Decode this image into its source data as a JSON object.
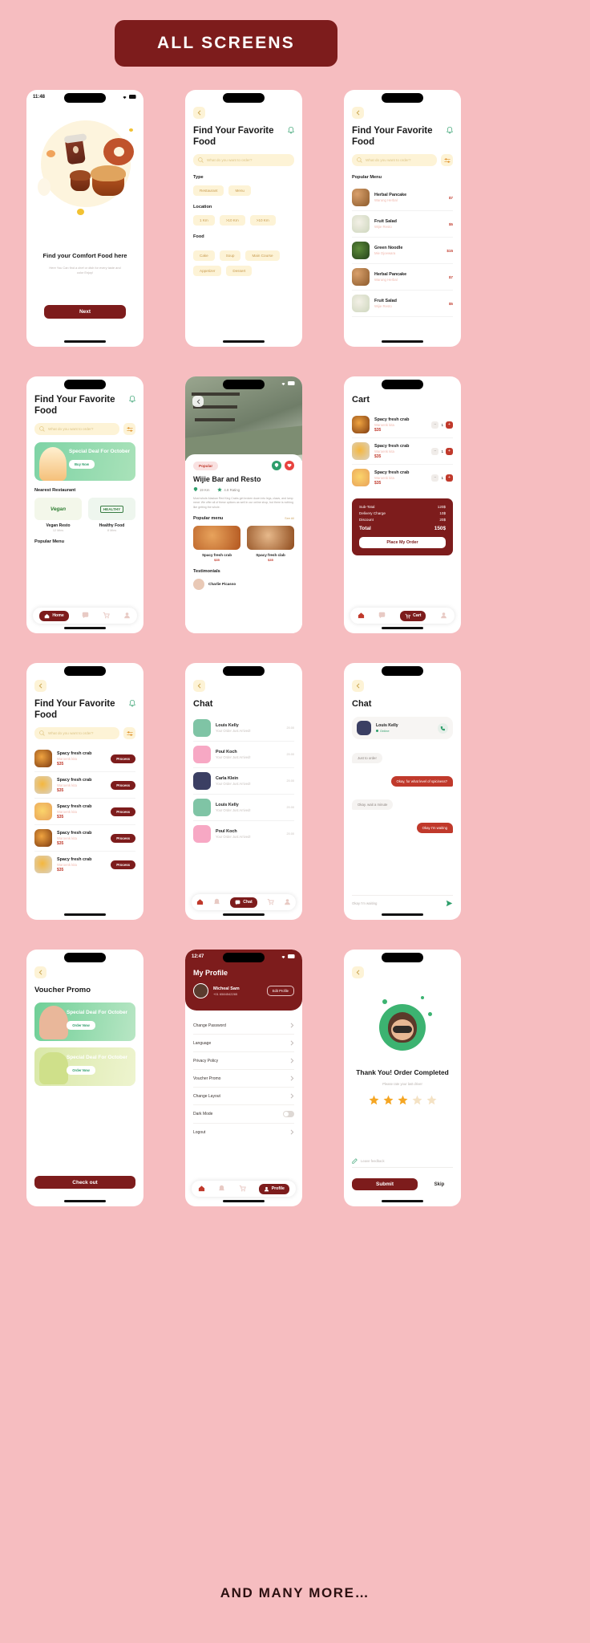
{
  "banner": {
    "title": "ALL SCREENS"
  },
  "footer": {
    "text": "AND MANY MORE…"
  },
  "colors": {
    "background": "#f6bdc0",
    "primary": "#7d1c1c",
    "accent_cream": "#fdf3d6",
    "green": "#2e9e6b",
    "price_red": "#c0392b"
  },
  "common": {
    "status_time": "11:48",
    "search_placeholder": "What do you want to order?",
    "back_icon": "chevron-left-icon",
    "bell_icon": "bell-icon",
    "search_icon": "search-icon",
    "filter_icon": "filter-icon"
  },
  "screens": [
    {
      "id": "onboarding",
      "status_time": "11:48",
      "headline": "Find your Comfort Food here",
      "subtext": "Here You Can find a chef or dish for every taste and color Enjoy!",
      "cta": "Next"
    },
    {
      "id": "search-filters",
      "title": "Find Your Favorite Food",
      "search_placeholder": "What do you want to order?",
      "sections": [
        {
          "label": "Type",
          "chips": [
            "Restaurant",
            "Menu"
          ]
        },
        {
          "label": "Location",
          "chips": [
            "1 Km",
            ">10 Km",
            ">10 Km"
          ]
        },
        {
          "label": "Food",
          "chips": [
            "Cake",
            "Soup",
            "Main Course",
            "Appetizer",
            "Dessert"
          ]
        }
      ]
    },
    {
      "id": "popular-menu",
      "title": "Find Your Favorite Food",
      "search_placeholder": "What do you want to order?",
      "section_label": "Popular Menu",
      "items": [
        {
          "name": "Herbal Pancake",
          "sub": "Warung Herbal",
          "price": "$7"
        },
        {
          "name": "Fruit Salad",
          "sub": "Wijie Resto",
          "price": "$5"
        },
        {
          "name": "Green Noodle",
          "sub": "Mie Djoewara",
          "price": "$15"
        },
        {
          "name": "Herbal Pancake",
          "sub": "Warung Herbal",
          "price": "$7"
        },
        {
          "name": "Fruit Salad",
          "sub": "Wijie Resto",
          "price": "$5"
        }
      ]
    },
    {
      "id": "home",
      "title": "Find Your Favorite Food",
      "search_placeholder": "What do you want to order?",
      "promo": {
        "title": "Special Deal For October",
        "cta": "Buy Now"
      },
      "nearest_label": "Nearest Restaurant",
      "restaurants": [
        {
          "name": "Vegan Resto",
          "distance": "12 Mins",
          "badge": "Vegan"
        },
        {
          "name": "Healthy Food",
          "distance": "8 Mins",
          "badge": "HEALTHY"
        }
      ],
      "popular_label": "Popular Menu",
      "nav": [
        "Home",
        "Chat",
        "Cart",
        "Profile"
      ],
      "nav_active": "Home"
    },
    {
      "id": "restaurant-detail",
      "badge": "Popular",
      "name": "Wijie Bar and Resto",
      "distance": "19 Km",
      "rating": "4.8 Rating",
      "description": "Must whole Alaskan Red King Crabs get broken down into legs, claws, and lump meat. We offer all of these options as well in our online shop, but there is nothing like getting the whole.",
      "popular_label": "Popular menu",
      "see_all": "See All",
      "menu": [
        {
          "name": "Spacy fresh crab",
          "price": "$35"
        },
        {
          "name": "Spacy fresh clab",
          "price": "$35"
        }
      ],
      "testimonials_label": "Testimonials",
      "testimonial_name": "Charlie Picasso"
    },
    {
      "id": "cart",
      "title": "Cart",
      "items": [
        {
          "name": "Spacy fresh crab",
          "sub": "Waroenk kita",
          "price": "$35",
          "qty": "1"
        },
        {
          "name": "Spacy fresh crab",
          "sub": "Waroenk kita",
          "price": "$35",
          "qty": "1"
        },
        {
          "name": "Spacy fresh crab",
          "sub": "Waroenk kita",
          "price": "$35",
          "qty": "1"
        }
      ],
      "summary": [
        {
          "label": "Sub-Total",
          "value": "120$"
        },
        {
          "label": "Delivery Charge",
          "value": "10$"
        },
        {
          "label": "Discount",
          "value": "20$"
        }
      ],
      "total_label": "Total",
      "total_value": "150$",
      "cta": "Place My Order",
      "nav": [
        "Home",
        "Chat",
        "Cart",
        "Profile"
      ],
      "nav_active": "Cart"
    },
    {
      "id": "order-process",
      "title": "Find Your Favorite Food",
      "search_placeholder": "What do you want to order?",
      "items": [
        {
          "name": "Spacy fresh crab",
          "sub": "Waroenk kita",
          "price": "$35",
          "action": "Process"
        },
        {
          "name": "Spacy fresh crab",
          "sub": "Waroenk kita",
          "price": "$35",
          "action": "Process"
        },
        {
          "name": "Spacy fresh crab",
          "sub": "Waroenk kita",
          "price": "$35",
          "action": "Process"
        },
        {
          "name": "Spacy fresh crab",
          "sub": "Waroenk kita",
          "price": "$35",
          "action": "Process"
        },
        {
          "name": "Spacy fresh crab",
          "sub": "Waroenk kita",
          "price": "$35",
          "action": "Process"
        }
      ]
    },
    {
      "id": "chat-list",
      "title": "Chat",
      "chats": [
        {
          "name": "Louis Kelly",
          "msg": "Your Order Just Arrived!",
          "time": "20.00",
          "color": "#7fc4a5"
        },
        {
          "name": "Poul Koch",
          "msg": "Your Order Just Arrived!",
          "time": "20.00",
          "color": "#f7a8c4"
        },
        {
          "name": "Carla Klein",
          "msg": "Your Order Just Arrived!",
          "time": "20.00",
          "color": "#3b3f63"
        },
        {
          "name": "Louis Kelly",
          "msg": "Your Order Just Arrived!",
          "time": "20.00",
          "color": "#7fc4a5"
        },
        {
          "name": "Poul Koch",
          "msg": "Your Order Just Arrived!",
          "time": "20.00",
          "color": "#f7a8c4"
        }
      ],
      "nav": [
        "Home",
        "Chat",
        "Cart",
        "Profile"
      ],
      "nav_active": "Chat"
    },
    {
      "id": "chat-room",
      "title": "Chat",
      "peer_name": "Louis Kelly",
      "peer_status": "Online",
      "call_icon": "phone-icon",
      "messages": [
        {
          "text": "Just to order",
          "side": "left"
        },
        {
          "text": "Okay, for what level of spiciness?",
          "side": "right"
        },
        {
          "text": "Okay. wait a minute",
          "side": "left"
        },
        {
          "text": "Okay I'm waiting",
          "side": "right"
        }
      ],
      "input_placeholder": "Okay I'm waiting",
      "send_icon": "send-icon"
    },
    {
      "id": "voucher-promo",
      "title": "Voucher Promo",
      "vouchers": [
        {
          "title": "Special Deal For October",
          "cta": "Order Now"
        },
        {
          "title": "Special Deal For October",
          "cta": "Order Now"
        }
      ],
      "cta": "Check out"
    },
    {
      "id": "profile",
      "status_time": "12:47",
      "title": "My Profile",
      "user_name": "Micheal Sam",
      "user_phone": "+01 6584542265",
      "edit_label": "Edit Profile",
      "settings": [
        {
          "label": "Change Password",
          "type": "link"
        },
        {
          "label": "Language",
          "type": "link"
        },
        {
          "label": "Privacy Policy",
          "type": "link"
        },
        {
          "label": "Voucher Promo",
          "type": "link"
        },
        {
          "label": "Change Layout",
          "type": "link"
        },
        {
          "label": "Dark Mode",
          "type": "toggle"
        },
        {
          "label": "Logout",
          "type": "link"
        }
      ],
      "nav": [
        "Home",
        "Chat",
        "Cart",
        "Profile"
      ],
      "nav_active": "Profile"
    },
    {
      "id": "order-completed",
      "headline": "Thank You! Order Completed",
      "subtext": "Please rate your last driver",
      "stars_filled": 3,
      "stars_total": 5,
      "feedback_placeholder": "Leave feedback",
      "primary_cta": "Submit",
      "secondary_cta": "Skip"
    }
  ]
}
